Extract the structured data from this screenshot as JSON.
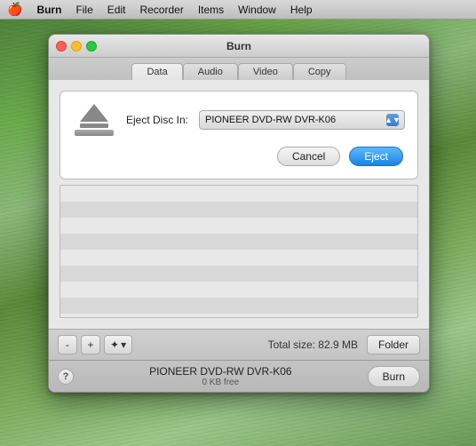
{
  "menubar": {
    "apple": "🍎",
    "items": [
      {
        "label": "Burn",
        "bold": true
      },
      {
        "label": "File"
      },
      {
        "label": "Edit"
      },
      {
        "label": "Recorder"
      },
      {
        "label": "Items"
      },
      {
        "label": "Window"
      },
      {
        "label": "Help"
      }
    ]
  },
  "window": {
    "title": "Burn",
    "tabs": [
      {
        "label": "Data",
        "active": true
      },
      {
        "label": "Audio",
        "active": false
      },
      {
        "label": "Video",
        "active": false
      },
      {
        "label": "Copy",
        "active": false
      }
    ],
    "eject_dialog": {
      "label": "Eject Disc In:",
      "disc_value": "PIONEER DVD-RW DVR-K06",
      "cancel_label": "Cancel",
      "eject_label": "Eject"
    },
    "bottom": {
      "minus_label": "-",
      "plus_label": "+",
      "gear_label": "✦",
      "chevron_label": "▾",
      "total_size": "Total size: 82.9 MB",
      "folder_label": "Folder"
    },
    "status": {
      "help_label": "?",
      "drive_name": "PIONEER DVD-RW DVR-K06",
      "drive_free": "0 KB free",
      "burn_label": "Burn"
    }
  }
}
